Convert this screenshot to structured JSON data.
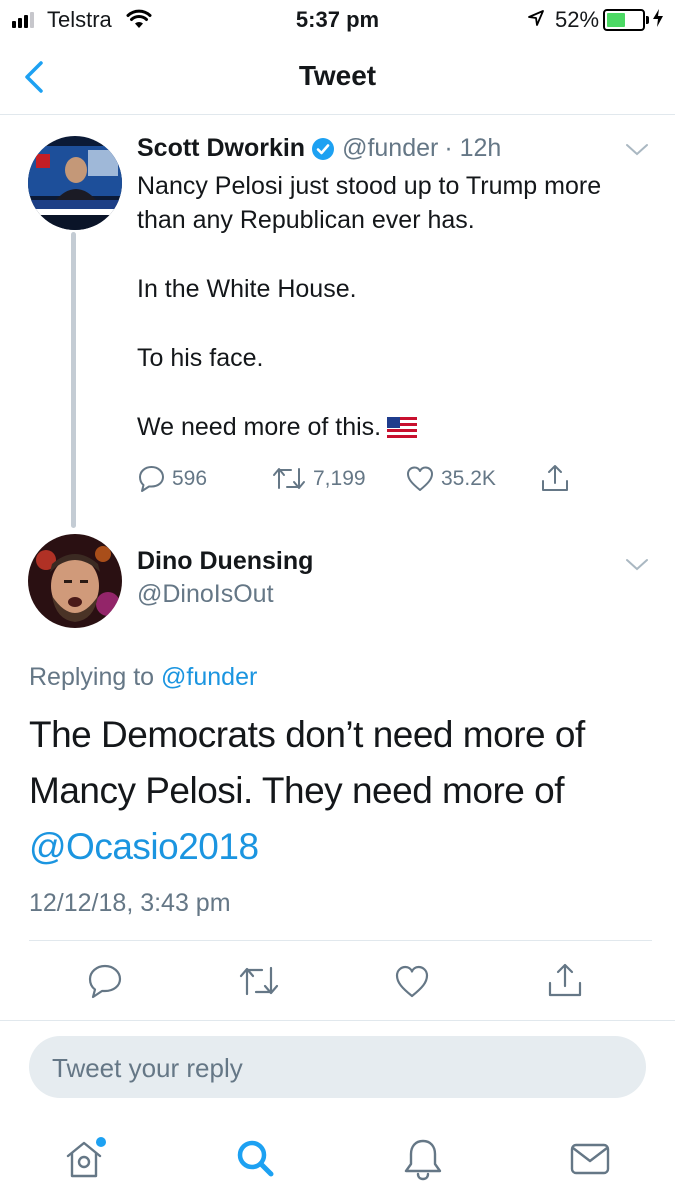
{
  "status_bar": {
    "carrier": "Telstra",
    "time": "5:37 pm",
    "battery_percent": "52%",
    "battery_level": 0.52,
    "battery_color": "#4cd964"
  },
  "nav": {
    "title": "Tweet",
    "back_icon": "chevron-left-icon"
  },
  "parent_tweet": {
    "author_name": "Scott Dworkin",
    "verified": true,
    "handle": "@funder",
    "age": "· 12h",
    "paragraphs": [
      "Nancy Pelosi just stood up to Trump more than any Republican ever has.",
      "In the White House.",
      "To his face.",
      "We need more of this."
    ],
    "emoji": "us-flag",
    "actions": {
      "replies": "596",
      "retweets": "7,199",
      "likes": "35.2K"
    }
  },
  "main_tweet": {
    "author_name": "Dino Duensing",
    "handle": "@DinoIsOut",
    "replying_prefix": "Replying to",
    "replying_handle": "@funder",
    "text_line1": "The Democrats don’t need more of",
    "text_line2": "Mancy Pelosi. They need more of",
    "mention": "@Ocasio2018",
    "timestamp": "12/12/18, 3:43 pm"
  },
  "reply_box": {
    "placeholder": "Tweet your reply"
  },
  "tab_bar": {
    "items": [
      "home-icon",
      "search-icon",
      "notifications-icon",
      "messages-icon"
    ],
    "active": "search-icon"
  },
  "colors": {
    "accent": "#1da1f2",
    "link": "#1b95e0",
    "secondary_text": "#657786",
    "verified": "#1da1f2"
  }
}
